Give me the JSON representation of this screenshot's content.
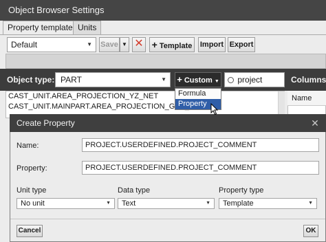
{
  "window": {
    "title": "Object Browser Settings"
  },
  "tabs": [
    {
      "label": "Property templates"
    },
    {
      "label": "Units"
    }
  ],
  "toolbar": {
    "template_value": "Default",
    "save_label": "Save",
    "template_label": "Template",
    "import_label": "Import",
    "export_label": "Export"
  },
  "filter": {
    "object_type_label": "Object type:",
    "object_type_value": "PART",
    "custom_label": "Custom",
    "search_value": "project",
    "columns_label": "Columns:"
  },
  "custom_menu": {
    "items": [
      {
        "label": "Formula"
      },
      {
        "label": "Property"
      }
    ],
    "selected": "Property"
  },
  "property_list": [
    "CAST_UNIT.AREA_PROJECTION_YZ_NET",
    "CAST_UNIT.MAINPART.AREA_PROJECTION_GXY_GROSS"
  ],
  "columns_panel": {
    "header": "Name"
  },
  "dialog": {
    "title": "Create Property",
    "name_label": "Name:",
    "name_value": "PROJECT.USERDEFINED.PROJECT_COMMENT",
    "property_label": "Property:",
    "property_value": "PROJECT.USERDEFINED.PROJECT_COMMENT",
    "unit_type_label": "Unit type",
    "unit_type_value": "No unit",
    "data_type_label": "Data type",
    "data_type_value": "Text",
    "property_type_label": "Property type",
    "property_type_value": "Template",
    "cancel_label": "Cancel",
    "ok_label": "OK"
  },
  "icons": {
    "close": "close-icon",
    "delete": "x-icon",
    "add": "plus-icon",
    "search": "search-icon",
    "dropdown": "chevron-down-icon"
  },
  "colors": {
    "title_bar": "#454545",
    "filter_bar": "#3c3c3c",
    "selection": "#2f5ea8",
    "delete_red": "#d23b2b"
  }
}
